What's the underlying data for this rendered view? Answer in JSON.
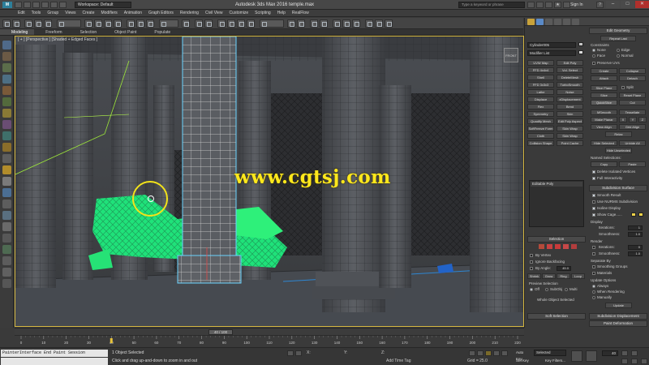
{
  "titlebar": {
    "logo": "M",
    "workspace": "Workspace: Default",
    "title": "Autodesk 3ds Max 2016    temple.max",
    "search_placeholder": "Type a keyword or phrase",
    "sign_in": "Sign In",
    "minimize": "–",
    "maximize": "□",
    "close": "✕"
  },
  "menu": [
    "Edit",
    "Tools",
    "Group",
    "Views",
    "Create",
    "Modifiers",
    "Animation",
    "Graph Editors",
    "Rendering",
    "Civil View",
    "Customize",
    "Scripting",
    "Help",
    "RealFlow"
  ],
  "ribbon": {
    "tabs": [
      "Modeling",
      "Freeform",
      "Selection",
      "Object Paint",
      "Populate"
    ]
  },
  "viewport": {
    "label": "[ + ] [Perspective ] [Shaded + Edged Faces ]",
    "viewcube": "FRONT",
    "watermark": "www.cgtsj.com"
  },
  "command_panel": {
    "object_name": "Cylinder005",
    "modifier_list": "Modifier List",
    "modifier_buttons": [
      [
        "UVW Map",
        "Edit Poly"
      ],
      [
        "FFD 4x4x4",
        "Vol. Select"
      ],
      [
        "Shell",
        "DeleteMesh"
      ],
      [
        "FFD 3x3x3",
        "TurboSmooth"
      ],
      [
        "Lathe",
        "Noise"
      ],
      [
        "Displace",
        "xDisplacement"
      ],
      [
        "Flex",
        "Bend"
      ],
      [
        "Symmetry",
        "Skin"
      ],
      [
        "Quadify Mesh",
        "Edit Poly Aspect"
      ],
      [
        "SoftFreeze Form",
        "Skin Wrap"
      ],
      [
        "Cloth",
        "Skin Wrap"
      ],
      [
        "Collision Shape",
        "Point Cache"
      ]
    ],
    "stack_item": "Editable Poly",
    "selection_rollout": "Selection",
    "by_vertex": "By Vertex",
    "ignore_backfacing": "Ignore Backfacing",
    "by_angle": "By Angle:",
    "by_angle_value": "45.0",
    "shrink": "Shrink",
    "grow": "Grow",
    "ring": "Ring",
    "loop": "Loop",
    "preview_selection": "Preview Selection",
    "preview_options": [
      "Off",
      "SubObj",
      "Multi"
    ],
    "whole_object": "Whole Object Selected",
    "soft_selection": "Soft Selection",
    "edit_geometry": "Edit Geometry",
    "repeat_last": "Repeat Last",
    "constraints": "Constraints",
    "constraint_options": [
      "None",
      "Edge",
      "Face",
      "Normal"
    ],
    "preserve_uvs": "Preserve UVs",
    "create": "Create",
    "collapse": "Collapse",
    "attach": "Attach",
    "detach": "Detach",
    "slice_plane": "Slice Plane",
    "split": "Split",
    "slice": "Slice",
    "reset_plane": "Reset Plane",
    "quickslice": "QuickSlice",
    "cut": "Cut",
    "msmooth": "MSmooth",
    "tessellate": "Tessellate",
    "make_planar": "Make Planar",
    "xyz": [
      "X",
      "Y",
      "Z"
    ],
    "view_align": "View Align",
    "grid_align": "Grid Align",
    "relax": "Relax",
    "hide_selected": "Hide Selected",
    "unhide_all": "Unhide All",
    "hide_unselected": "Hide Unselected",
    "named_selections": "Named Selections:",
    "copy": "Copy",
    "paste": "Paste",
    "delete_isolated": "Delete Isolated Vertices",
    "full_interactivity": "Full Interactivity",
    "subdivision_surface": "Subdivision Surface",
    "smooth_result": "Smooth Result",
    "use_nurms": "Use NURMS Subdivision",
    "isoline_display": "Isoline Display",
    "show_cage": "Show Cage......",
    "cage_color_1": "#f0d34a",
    "cage_color_2": "#f0d34a",
    "display": "Display",
    "iterations": "Iterations:",
    "iterations_value": "1",
    "smoothness": "Smoothness:",
    "smoothness_value": "1.0",
    "render": "Render",
    "render_iterations_value": "0",
    "render_smoothness_value": "1.0",
    "separate_by": "Separate By",
    "smoothing_groups": "Smoothing Groups",
    "materials": "Materials",
    "update_options": "Update Options",
    "always": "Always",
    "when_rendering": "When Rendering",
    "manually": "Manually",
    "update": "Update",
    "subdivision_displacement": "Subdivision Displacement",
    "paint_deformation": "Paint Deformation"
  },
  "timeline": {
    "thumb": "40 / 100",
    "progress": 0.4,
    "ticks": [
      "0",
      "10",
      "20",
      "30",
      "40",
      "50",
      "60",
      "70",
      "80",
      "90",
      "100",
      "110",
      "120",
      "130",
      "140",
      "150",
      "160",
      "170",
      "180",
      "190",
      "200",
      "210",
      "220"
    ]
  },
  "status": {
    "maxscript": "PainterInterface End Paint Session",
    "objects_selected": "1 Object Selected",
    "prompt": "Click and drag up-and-down to zoom in and out",
    "x_label": "X:",
    "y_label": "Y:",
    "z_label": "Z:",
    "grid": "Grid = 25.0",
    "add_time_tag": "Add Time Tag",
    "auto_key": "Auto Key",
    "set_key": "Set Key",
    "key_mode": "Selected",
    "key_filters": "Key Filters...",
    "frame": "40"
  },
  "colors": {
    "accent": "#d4b640",
    "selection_green": "#2ef07a",
    "wire_blue": "#6ad4ff",
    "watermark": "#ffe81c"
  }
}
